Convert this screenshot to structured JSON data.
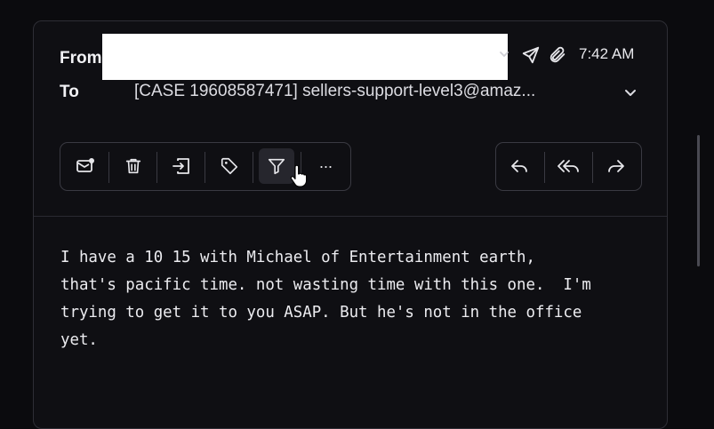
{
  "header": {
    "from_label": "From",
    "to_label": "To",
    "to_value": "[CASE 19608587471] sellers-support-level3@amaz...",
    "time": "7:42 AM"
  },
  "toolbar": {
    "actions": [
      "mark-unread",
      "delete",
      "move",
      "label",
      "filter",
      "more"
    ],
    "more_label": "···"
  },
  "reply_actions": [
    "reply",
    "reply-all",
    "forward"
  ],
  "message": {
    "body": "I have a 10 15 with Michael of Entertainment earth,\nthat's pacific time. not wasting time with this one.  I'm\ntrying to get it to you ASAP. But he's not in the office\nyet."
  }
}
